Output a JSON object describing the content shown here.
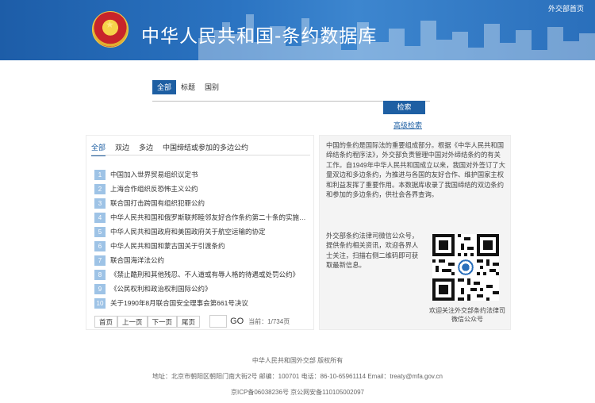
{
  "header": {
    "title_part1": "中华人民共和国",
    "separator": "-",
    "title_part2": "条约数据库",
    "top_link": "外交部首页"
  },
  "search": {
    "tabs": [
      "全部",
      "标题",
      "国别"
    ],
    "active_tab": 0,
    "input_value": "",
    "button_label": "检索",
    "advanced_link": "高级检索"
  },
  "list": {
    "type_tabs": [
      "全部",
      "双边",
      "多边",
      "中国缔结或参加的多边公约"
    ],
    "active_type_tab": 0,
    "items": [
      {
        "num": "1",
        "title": "中国加入世界贸易组织议定书"
      },
      {
        "num": "2",
        "title": "上海合作组织反恐怖主义公约"
      },
      {
        "num": "3",
        "title": "联合国打击跨国有组织犯罪公约"
      },
      {
        "num": "4",
        "title": "中华人民共和国和俄罗斯联邦睦邻友好合作条约第二十条的实施纲要"
      },
      {
        "num": "5",
        "title": "中华人民共和国政府和美国政府关于航空运输的协定"
      },
      {
        "num": "6",
        "title": "中华人民共和国和蒙古国关于引渡条约"
      },
      {
        "num": "7",
        "title": "联合国海洋法公约"
      },
      {
        "num": "8",
        "title": "《禁止酷刑和其他残忍、不人道或有辱人格的待遇或处罚公约》"
      },
      {
        "num": "9",
        "title": "《公民权利和政治权利国际公约》"
      },
      {
        "num": "10",
        "title": "关于1990年8月联合国安全理事会第661号决议"
      }
    ],
    "pager": {
      "first": "首页",
      "prev": "上一页",
      "next": "下一页",
      "last": "尾页",
      "go": "GO",
      "page_info": "当前：1/734页"
    }
  },
  "info": {
    "intro": "中国的条约是国际法的重要组成部分。根据《中华人民共和国缔结条约程序法》，外交部负责管理中国对外缔结条约的有关工作。自1949年中华人民共和国成立以来，我国对外签订了大量双边和多边条约，为推进与各国的友好合作、维护国家主权和利益发挥了重要作用。本数据库收录了我国缔结的双边条约和参加的多边条约，供社会各界查询。",
    "qr_text": "外交部条约法律司微信公众号，提供条约相关资讯，欢迎各界人士关注，扫描右侧二维码即可获取最新信息。",
    "qr_caption": "欢迎关注外交部条约法律司微信公众号"
  },
  "footer": {
    "line1": "中华人民共和国外交部 版权所有",
    "line2": "地址：北京市朝阳区朝阳门南大街2号  邮编：100701  电话：86-10-65961114  Email：treaty@mfa.gov.cn",
    "line3": "京ICP备06038236号  京公网安备110105002097"
  }
}
